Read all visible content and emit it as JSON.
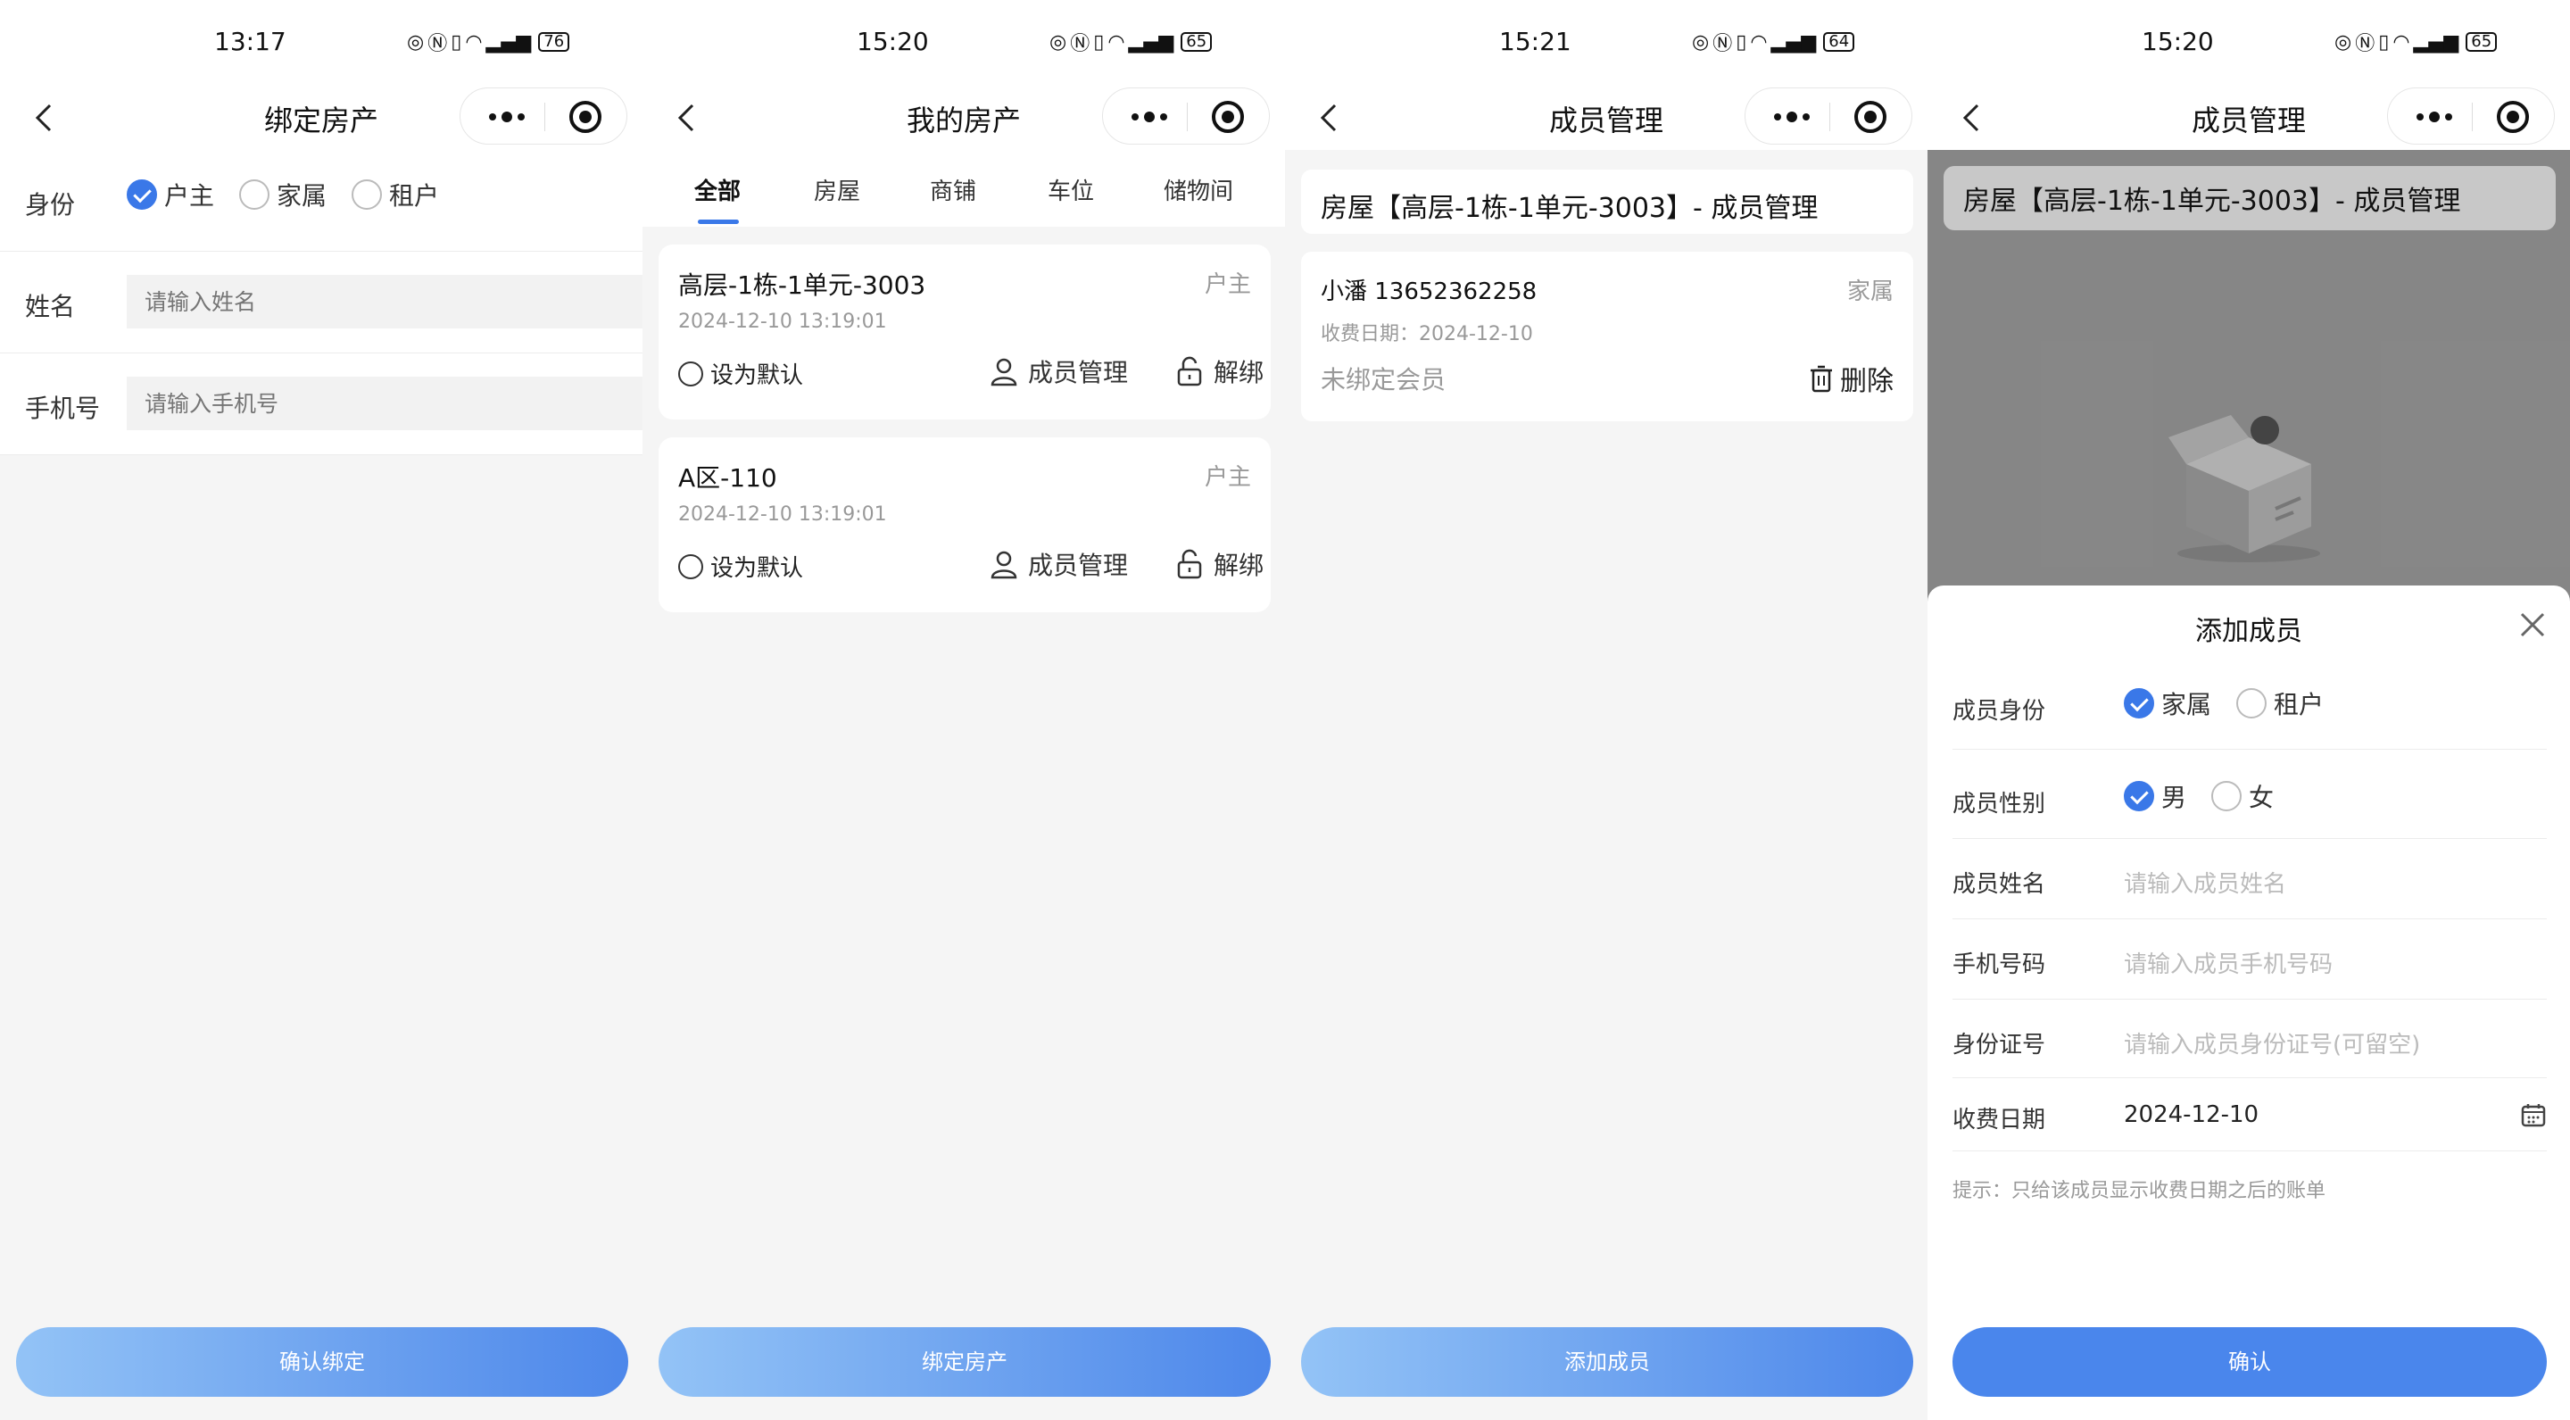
{
  "screens": [
    {
      "status": {
        "time": "13:17",
        "battery": "76"
      },
      "nav": {
        "title": "绑定房产"
      },
      "form": {
        "identity_label": "身份",
        "identity_options": [
          "户主",
          "家属",
          "租户"
        ],
        "name_label": "姓名",
        "name_placeholder": "请输入姓名",
        "phone_label": "手机号",
        "phone_placeholder": "请输入手机号"
      },
      "button": "确认绑定"
    },
    {
      "status": {
        "time": "15:20",
        "battery": "65"
      },
      "nav": {
        "title": "我的房产"
      },
      "tabs": [
        "全部",
        "房屋",
        "商铺",
        "车位",
        "储物间"
      ],
      "properties": [
        {
          "name": "高层-1栋-1单元-3003",
          "role": "户主",
          "date": "2024-12-10 13:19:01",
          "default_label": "设为默认",
          "member_label": "成员管理",
          "unbind_label": "解绑"
        },
        {
          "name": "A区-110",
          "role": "户主",
          "date": "2024-12-10 13:19:01",
          "default_label": "设为默认",
          "member_label": "成员管理",
          "unbind_label": "解绑"
        }
      ],
      "button": "绑定房产"
    },
    {
      "status": {
        "time": "15:21",
        "battery": "64"
      },
      "nav": {
        "title": "成员管理"
      },
      "house": "房屋【高层-1栋-1单元-3003】- 成员管理",
      "member": {
        "name": "小潘 13652362258",
        "role": "家属",
        "date": "收费日期：2024-12-10",
        "status": "未绑定会员",
        "delete_label": "删除"
      },
      "button": "添加成员"
    },
    {
      "status": {
        "time": "15:20",
        "battery": "65"
      },
      "nav": {
        "title": "成员管理"
      },
      "house": "房屋【高层-1栋-1单元-3003】- 成员管理",
      "sheet": {
        "title": "添加成员",
        "identity_label": "成员身份",
        "identity_options": [
          "家属",
          "租户"
        ],
        "gender_label": "成员性别",
        "gender_options": [
          "男",
          "女"
        ],
        "name_label": "成员姓名",
        "name_placeholder": "请输入成员姓名",
        "phone_label": "手机号码",
        "phone_placeholder": "请输入成员手机号码",
        "id_label": "身份证号",
        "id_placeholder": "请输入成员身份证号(可留空)",
        "date_label": "收费日期",
        "date_value": "2024-12-10",
        "hint": "提示：只给该成员显示收费日期之后的账单"
      },
      "button": "确认"
    }
  ],
  "colors": {
    "accent": "#3a78e8",
    "gradient_start": "#93c3f6",
    "gradient_end": "#4d87ea"
  },
  "icons": [
    "back-icon",
    "more-icon",
    "target-icon",
    "user-icon",
    "unlock-icon",
    "trash-icon",
    "close-icon",
    "calendar-icon",
    "empty-box-icon"
  ]
}
